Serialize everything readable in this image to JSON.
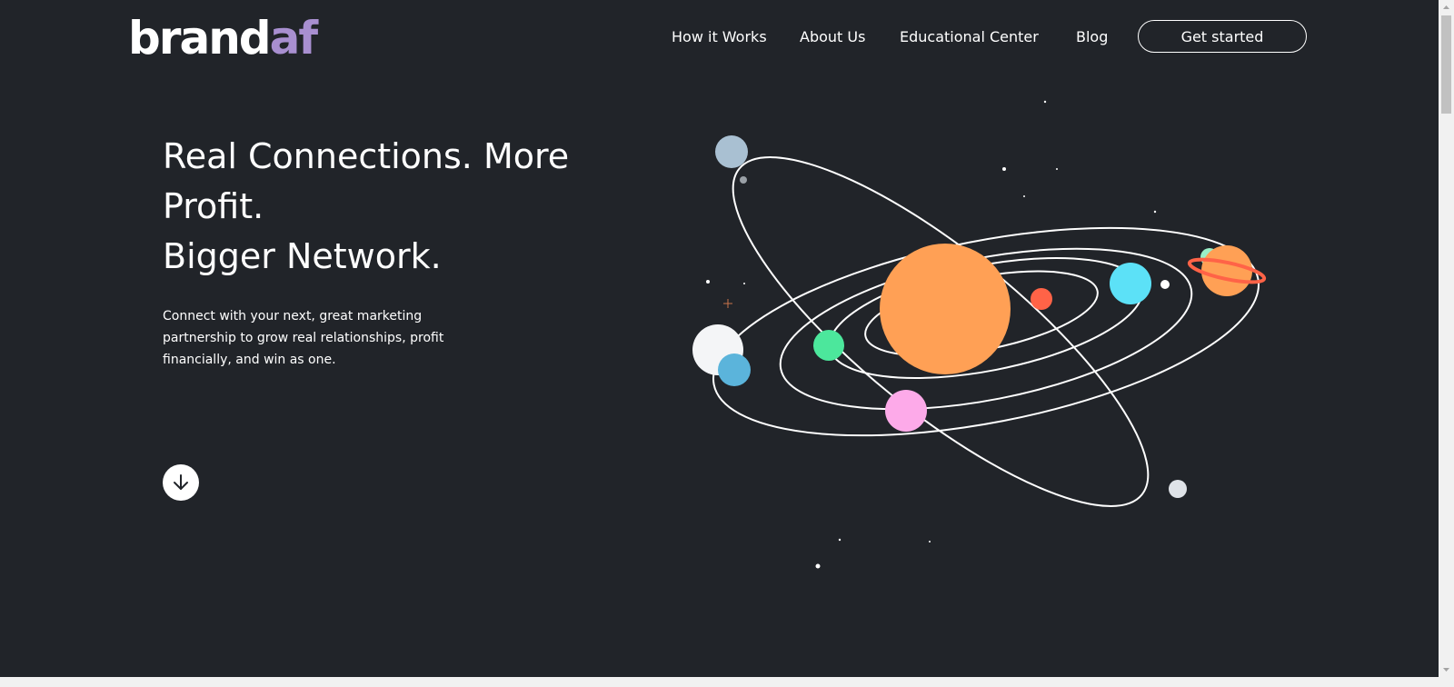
{
  "header": {
    "logo_part1": "brand",
    "logo_part2": "af",
    "nav": {
      "how_it_works": "How it Works",
      "about_us": "About Us",
      "educational_center": "Educational Center",
      "blog": "Blog"
    },
    "cta_label": "Get started"
  },
  "hero": {
    "title_line1": "Real Connections. More",
    "title_line2": "Profit.",
    "title_line3": "Bigger Network.",
    "subtitle": "Connect with your next, great marketing partnership to grow real relationships, profit financially, and win as one."
  },
  "icons": {
    "scroll_down": "arrow-down-icon",
    "illustration": "solar-system-illustration"
  },
  "colors": {
    "background": "#212429",
    "logo_accent": "#a88fd0",
    "sun": "#ffa055",
    "planet_red": "#ff6347",
    "planet_cyan": "#5ce1f7",
    "planet_green": "#4ce79c",
    "planet_pink": "#fdaae9",
    "planet_blue": "#5bb4db",
    "planet_grayblue": "#a9c0d2"
  }
}
